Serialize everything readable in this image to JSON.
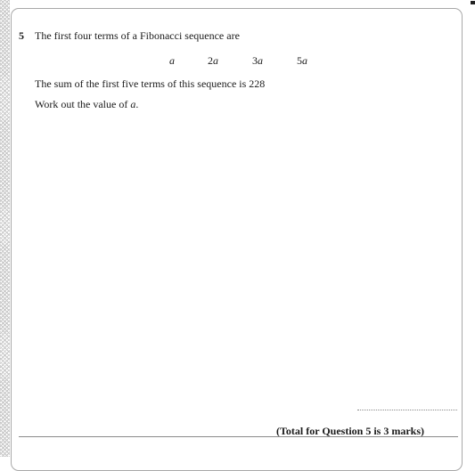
{
  "question": {
    "number": "5",
    "intro": "The first four terms of a Fibonacci sequence are",
    "terms": [
      "a",
      "2a",
      "3a",
      "5a"
    ],
    "sum_statement": "The sum of the first five terms of this sequence is 228",
    "instruction_prefix": "Work out the value of ",
    "instruction_var": "a",
    "instruction_suffix": ".",
    "total": "(Total for Question 5 is 3 marks)"
  }
}
